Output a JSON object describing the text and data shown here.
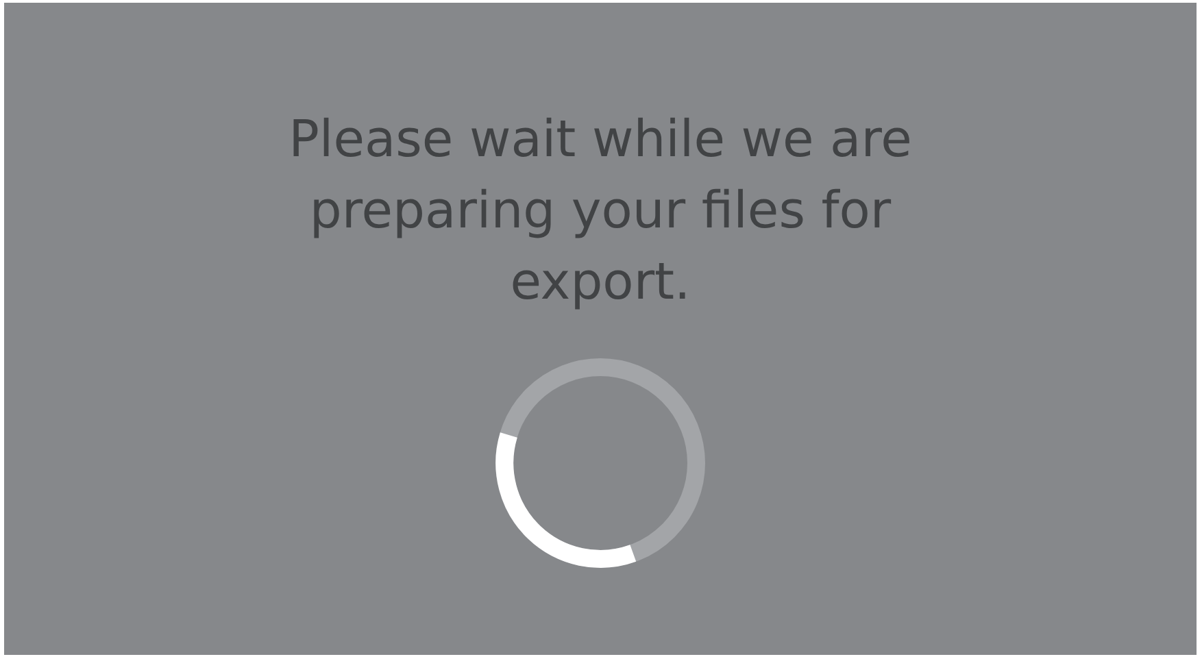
{
  "message": "Please wait while we are preparing your files for export."
}
